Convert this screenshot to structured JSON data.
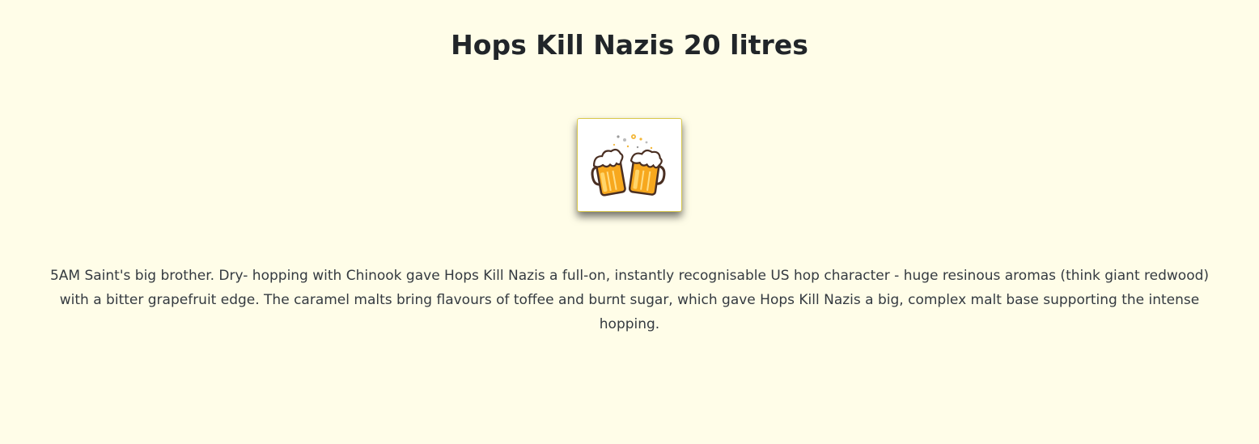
{
  "product": {
    "title": "Hops Kill Nazis 20 litres",
    "image_icon": "beer-mugs-cheers-icon",
    "description": "5AM Saint's big brother. Dry- hopping with Chinook gave Hops Kill Nazis a full-on, instantly recognisable US hop character - huge resinous aromas (think giant redwood) with a bitter grapefruit edge. The caramel malts bring flavours of toffee and burnt sugar, which gave Hops Kill Nazis a big, complex malt base supporting the intense hopping."
  },
  "colors": {
    "background": "#fffde8",
    "beer": "#f5a623",
    "foam": "#ffffff",
    "card_border": "#d9c84a"
  }
}
